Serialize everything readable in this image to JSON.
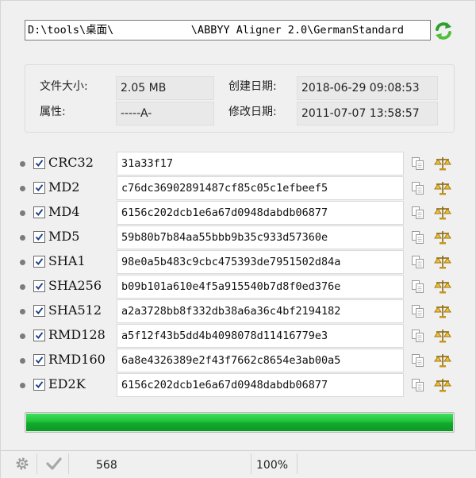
{
  "path": {
    "value": "D:\\tools\\桌面\\            \\ABBYY Aligner 2.0\\GermanStandard"
  },
  "refresh": {
    "icon": "refresh-icon"
  },
  "info": {
    "size_label": "文件大小:",
    "size_value": "2.05 MB",
    "attr_label": "属性:",
    "attr_value": "-----A-",
    "created_label": "创建日期:",
    "created_value": "2018-06-29 09:08:53",
    "modified_label": "修改日期:",
    "modified_value": "2011-07-07 13:58:57"
  },
  "hashes": [
    {
      "name": "CRC32",
      "value": "31a33f17",
      "checked": true
    },
    {
      "name": "MD2",
      "value": "c76dc36902891487cf85c05c1efbeef5",
      "checked": true
    },
    {
      "name": "MD4",
      "value": "6156c202dcb1e6a67d0948dabdb06877",
      "checked": true
    },
    {
      "name": "MD5",
      "value": "59b80b7b84aa55bbb9b35c933d57360e",
      "checked": true
    },
    {
      "name": "SHA1",
      "value": "98e0a5b483c9cbc475393de7951502d84a",
      "checked": true
    },
    {
      "name": "SHA256",
      "value": "b09b101a610e4f5a915540b7d8f0ed376e",
      "checked": true
    },
    {
      "name": "SHA512",
      "value": "a2a3728bb8f332db38a6a36c4bf2194182",
      "checked": true
    },
    {
      "name": "RMD128",
      "value": "a5f12f43b5dd4b4098078d11416779e3",
      "checked": true
    },
    {
      "name": "RMD160",
      "value": "6a8e4326389e2f43f7662c8654e3ab00a5",
      "checked": true
    },
    {
      "name": "ED2K",
      "value": "6156c202dcb1e6a67d0948dabdb06877",
      "checked": true
    }
  ],
  "progress": {
    "fraction": 1.0
  },
  "status": {
    "count": "568",
    "percent": "100%",
    "settings_icon": "gear-icon",
    "check_icon": "checkmark-icon"
  },
  "colors": {
    "progress": "#1fc23a",
    "refresh": "#2e9e2e"
  }
}
